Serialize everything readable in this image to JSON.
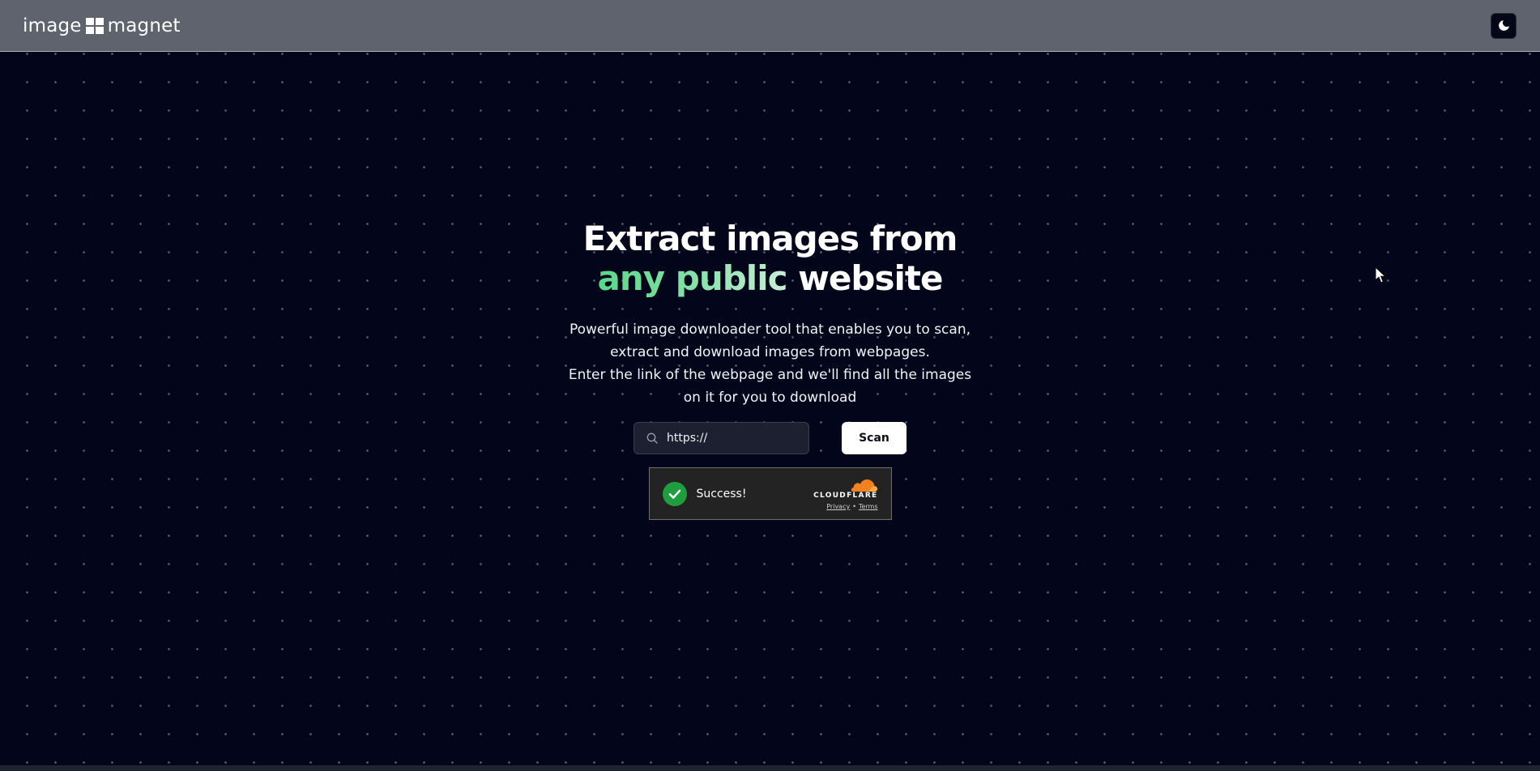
{
  "header": {
    "logo_left": "image",
    "logo_right": "magnet",
    "theme_toggle_icon": "moon-icon"
  },
  "hero": {
    "title_line1": "Extract images from",
    "title_accent": "any public",
    "title_rest": " website",
    "subtitle_line1": "Powerful image downloader tool that enables you to scan, extract and download images from webpages.",
    "subtitle_line2": "Enter the link of the webpage and we'll find all the images on it for you to download"
  },
  "search": {
    "value": "https://",
    "icon": "search-icon",
    "scan_label": "Scan"
  },
  "captcha": {
    "status": "Success!",
    "provider": "CLOUDFLARE",
    "privacy_label": "Privacy",
    "separator": "•",
    "terms_label": "Terms"
  },
  "colors": {
    "background": "#03051a",
    "header": "#5f636d",
    "accent_green": "#58d889",
    "success_green": "#1e9e3e",
    "cloudflare_orange": "#f48120"
  }
}
